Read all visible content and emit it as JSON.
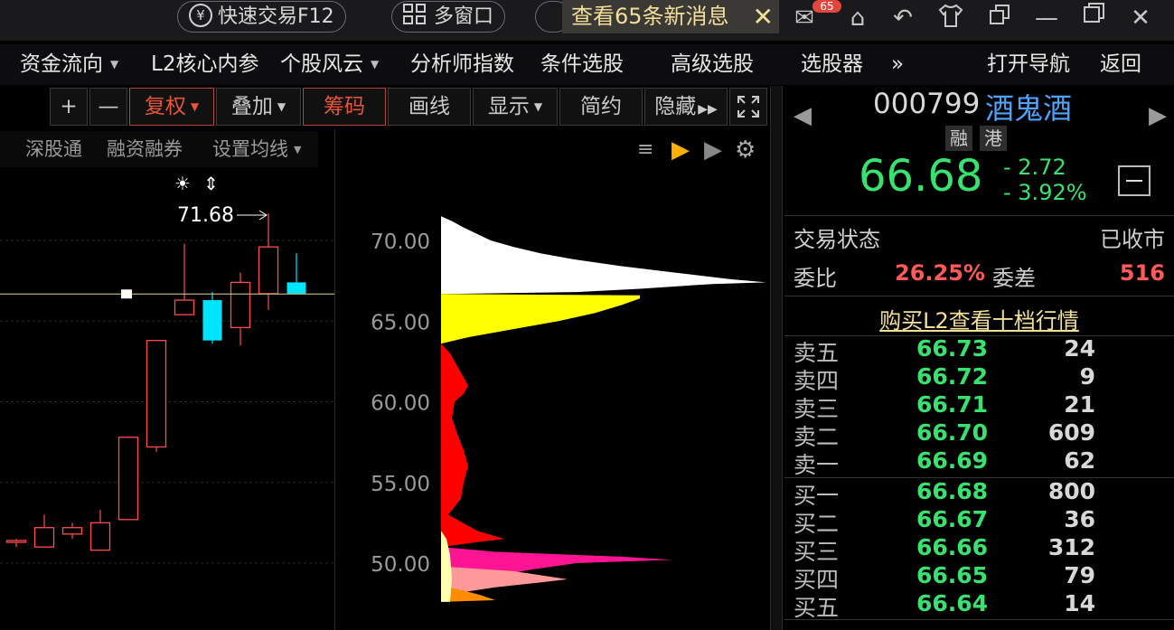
{
  "titlebar": {
    "quick_trade": "快速交易F12",
    "quick_trade_icon": "¥",
    "multi_window": "多窗口",
    "notification": "查看65条新消息",
    "badge": "65"
  },
  "menu": [
    {
      "label": "资金流向",
      "dropdown": true
    },
    {
      "label": "L2核心内参",
      "dropdown": false
    },
    {
      "label": "个股风云",
      "dropdown": true
    },
    {
      "label": "分析师指数",
      "dropdown": false
    },
    {
      "label": "条件选股",
      "dropdown": false
    },
    {
      "label": "高级选股",
      "dropdown": false
    },
    {
      "label": "选股器",
      "dropdown": false
    },
    {
      "label": "»",
      "dropdown": false
    },
    {
      "label": "打开导航",
      "dropdown": false
    },
    {
      "label": "返回",
      "dropdown": false
    }
  ],
  "toolbar": {
    "plus": "+",
    "minus": "—",
    "fuquan": "复权",
    "overlay": "叠加",
    "chips": "筹码",
    "draw": "画线",
    "display": "显示",
    "simple": "简约",
    "hide": "隐藏"
  },
  "subbar": {
    "sz_connect": "深股通",
    "margin": "融资融券",
    "ma_setting": "设置均线"
  },
  "chart": {
    "high_label": "71.68",
    "axis_ticks": [
      "70.00",
      "65.00",
      "60.00",
      "55.00",
      "50.00"
    ]
  },
  "chart_data": {
    "type": "candlestick",
    "y_range": [
      47.6,
      72.6
    ],
    "candles": [
      {
        "open": 51.3,
        "close": 51.4,
        "high": 51.5,
        "low": 51.0,
        "up": true
      },
      {
        "open": 51.0,
        "close": 52.2,
        "high": 53.0,
        "low": 51.0,
        "up": true
      },
      {
        "open": 51.8,
        "close": 52.2,
        "high": 52.5,
        "low": 51.5,
        "up": true
      },
      {
        "open": 50.8,
        "close": 52.5,
        "high": 53.3,
        "low": 50.8,
        "up": true
      },
      {
        "open": 52.7,
        "close": 57.8,
        "high": 57.8,
        "low": 52.7,
        "up": true
      },
      {
        "open": 57.2,
        "close": 63.8,
        "high": 63.8,
        "low": 56.9,
        "up": true
      },
      {
        "open": 65.4,
        "close": 66.3,
        "high": 69.8,
        "low": 65.4,
        "up": true
      },
      {
        "open": 66.3,
        "close": 63.8,
        "high": 66.8,
        "low": 63.6,
        "up": false
      },
      {
        "open": 64.6,
        "close": 67.4,
        "high": 68.0,
        "low": 63.5,
        "up": true
      },
      {
        "open": 66.7,
        "close": 69.6,
        "high": 71.68,
        "low": 65.7,
        "up": true
      },
      {
        "open": 67.4,
        "close": 66.7,
        "high": 69.2,
        "low": 66.7,
        "up": false
      }
    ],
    "current_price": 66.68,
    "chips": {
      "profit_color": "#ffffff",
      "profit_lower_color": "#ffff00",
      "loss_colors": [
        "#ff0000",
        "#ff1493",
        "#ff9999",
        "#ff8c00",
        "#ffffb0"
      ]
    }
  },
  "stock": {
    "code": "000799",
    "name": "酒鬼酒",
    "tag1": "融",
    "tag2": "港",
    "price": "66.68",
    "change": "- 2.72",
    "change_pct": "- 3.92%",
    "status_label": "交易状态",
    "status_value": "已收市",
    "weibi_label": "委比",
    "weibi_value": "26.25%",
    "weicha_label": "委差",
    "weicha_value": "516",
    "l2_link": "购买L2查看十档行情"
  },
  "orderbook": {
    "asks": [
      {
        "label": "卖五",
        "price": "66.73",
        "vol": "24"
      },
      {
        "label": "卖四",
        "price": "66.72",
        "vol": "9"
      },
      {
        "label": "卖三",
        "price": "66.71",
        "vol": "21"
      },
      {
        "label": "卖二",
        "price": "66.70",
        "vol": "609"
      },
      {
        "label": "卖一",
        "price": "66.69",
        "vol": "62"
      }
    ],
    "bids": [
      {
        "label": "买一",
        "price": "66.68",
        "vol": "800"
      },
      {
        "label": "买二",
        "price": "66.67",
        "vol": "36"
      },
      {
        "label": "买三",
        "price": "66.66",
        "vol": "312"
      },
      {
        "label": "买四",
        "price": "66.65",
        "vol": "79"
      },
      {
        "label": "买五",
        "price": "66.64",
        "vol": "14"
      }
    ]
  },
  "colors": {
    "up": "#ff4d4d",
    "down": "#00e5ff",
    "green": "#37e26e",
    "accent": "#e6553a"
  }
}
